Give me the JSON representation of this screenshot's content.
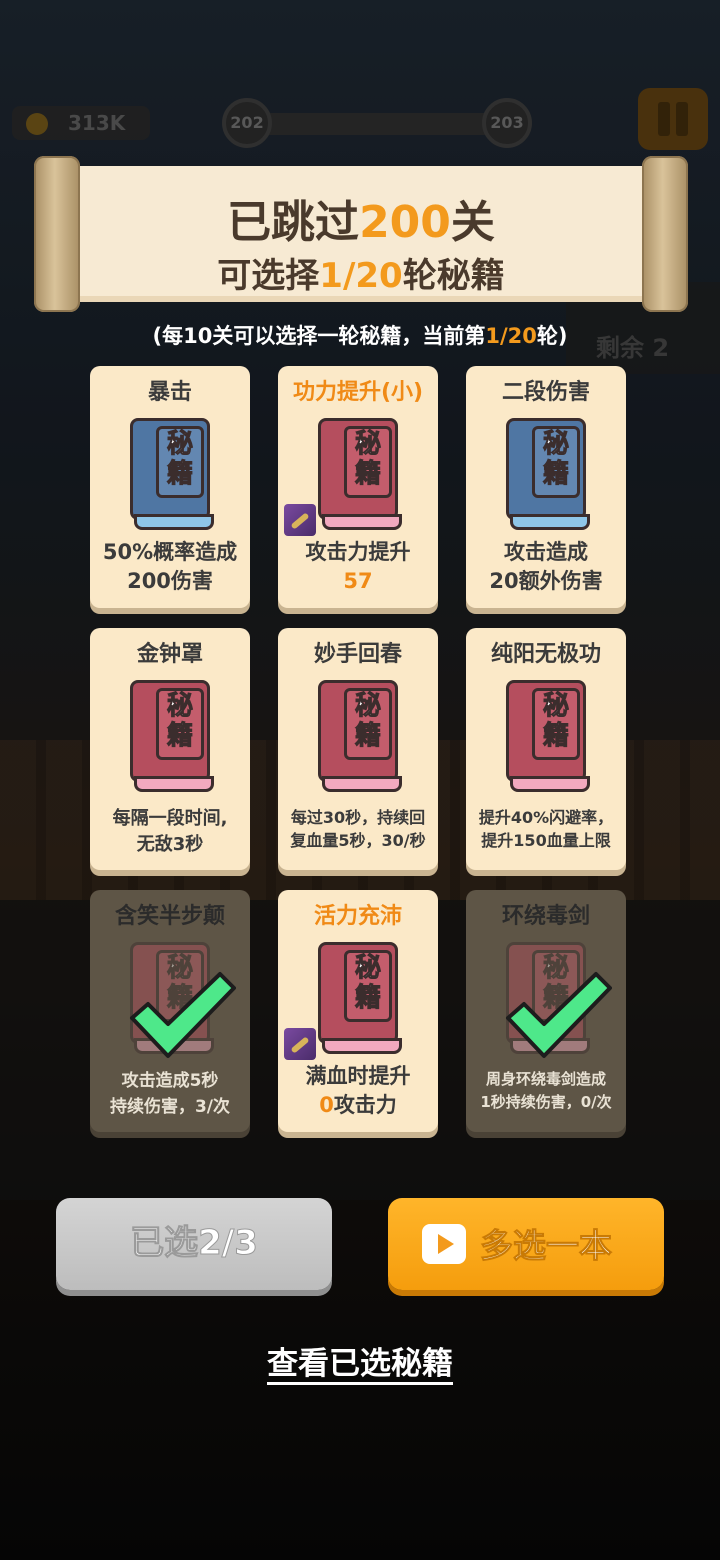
{
  "hud": {
    "coins": "313K",
    "level_from": "202",
    "level_to": "203",
    "remain_label": "剩余",
    "remain_count": "2"
  },
  "scroll": {
    "line1_prefix": "已跳过",
    "line1_number": "200",
    "line1_suffix": "关",
    "line2_prefix": "可选择",
    "line2_number": "1/20",
    "line2_suffix": "轮秘籍"
  },
  "note": {
    "prefix": "(每10关可以选择一轮秘籍，当前第",
    "highlight": "1/20",
    "suffix": "轮)"
  },
  "book_label": "秘籍",
  "cards": [
    {
      "title": "暴击",
      "desc1": "50%概率造成",
      "desc2": "200伤害"
    },
    {
      "title": "功力提升(小)",
      "desc1": "攻击力提升",
      "desc2": "57"
    },
    {
      "title": "二段伤害",
      "desc1": "攻击造成",
      "desc2": "20额外伤害"
    },
    {
      "title": "金钟罩",
      "desc1": "每隔一段时间,",
      "desc2": "无敌3秒"
    },
    {
      "title": "妙手回春",
      "desc1": "每过30秒，持续回",
      "desc2": "复血量5秒，30/秒"
    },
    {
      "title": "纯阳无极功",
      "desc1": "提升40%闪避率，",
      "desc2": "提升150血量上限"
    },
    {
      "title": "含笑半步颠",
      "desc1": "攻击造成5秒",
      "desc2": "持续伤害，3/次"
    },
    {
      "title": "活力充沛",
      "desc1_num": "满血时提升",
      "desc2_num": "0",
      "desc2_rest": "攻击力"
    },
    {
      "title": "环绕毒剑",
      "desc1": "周身环绕毒剑造成",
      "desc2": "1秒持续伤害，0/次"
    }
  ],
  "buttons": {
    "selected": "已选2/3",
    "more": "多选一本",
    "view": "查看已选秘籍"
  },
  "colors": {
    "accent": "#f39a1d",
    "card_bg": "#fbe9c8",
    "book_blue": "#4f76a3",
    "book_red": "#b54e5e",
    "check_green": "#4ee88a"
  }
}
